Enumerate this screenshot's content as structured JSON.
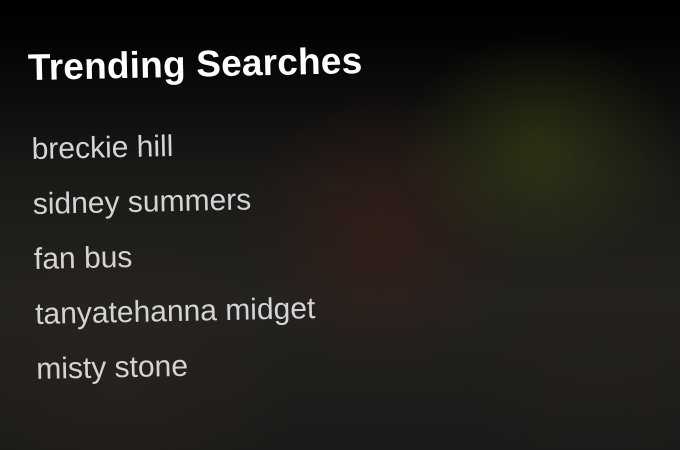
{
  "trending": {
    "title": "Trending Searches",
    "items": [
      "breckie hill",
      "sidney summers",
      "fan bus",
      "tanyatehanna midget",
      "misty stone"
    ]
  }
}
